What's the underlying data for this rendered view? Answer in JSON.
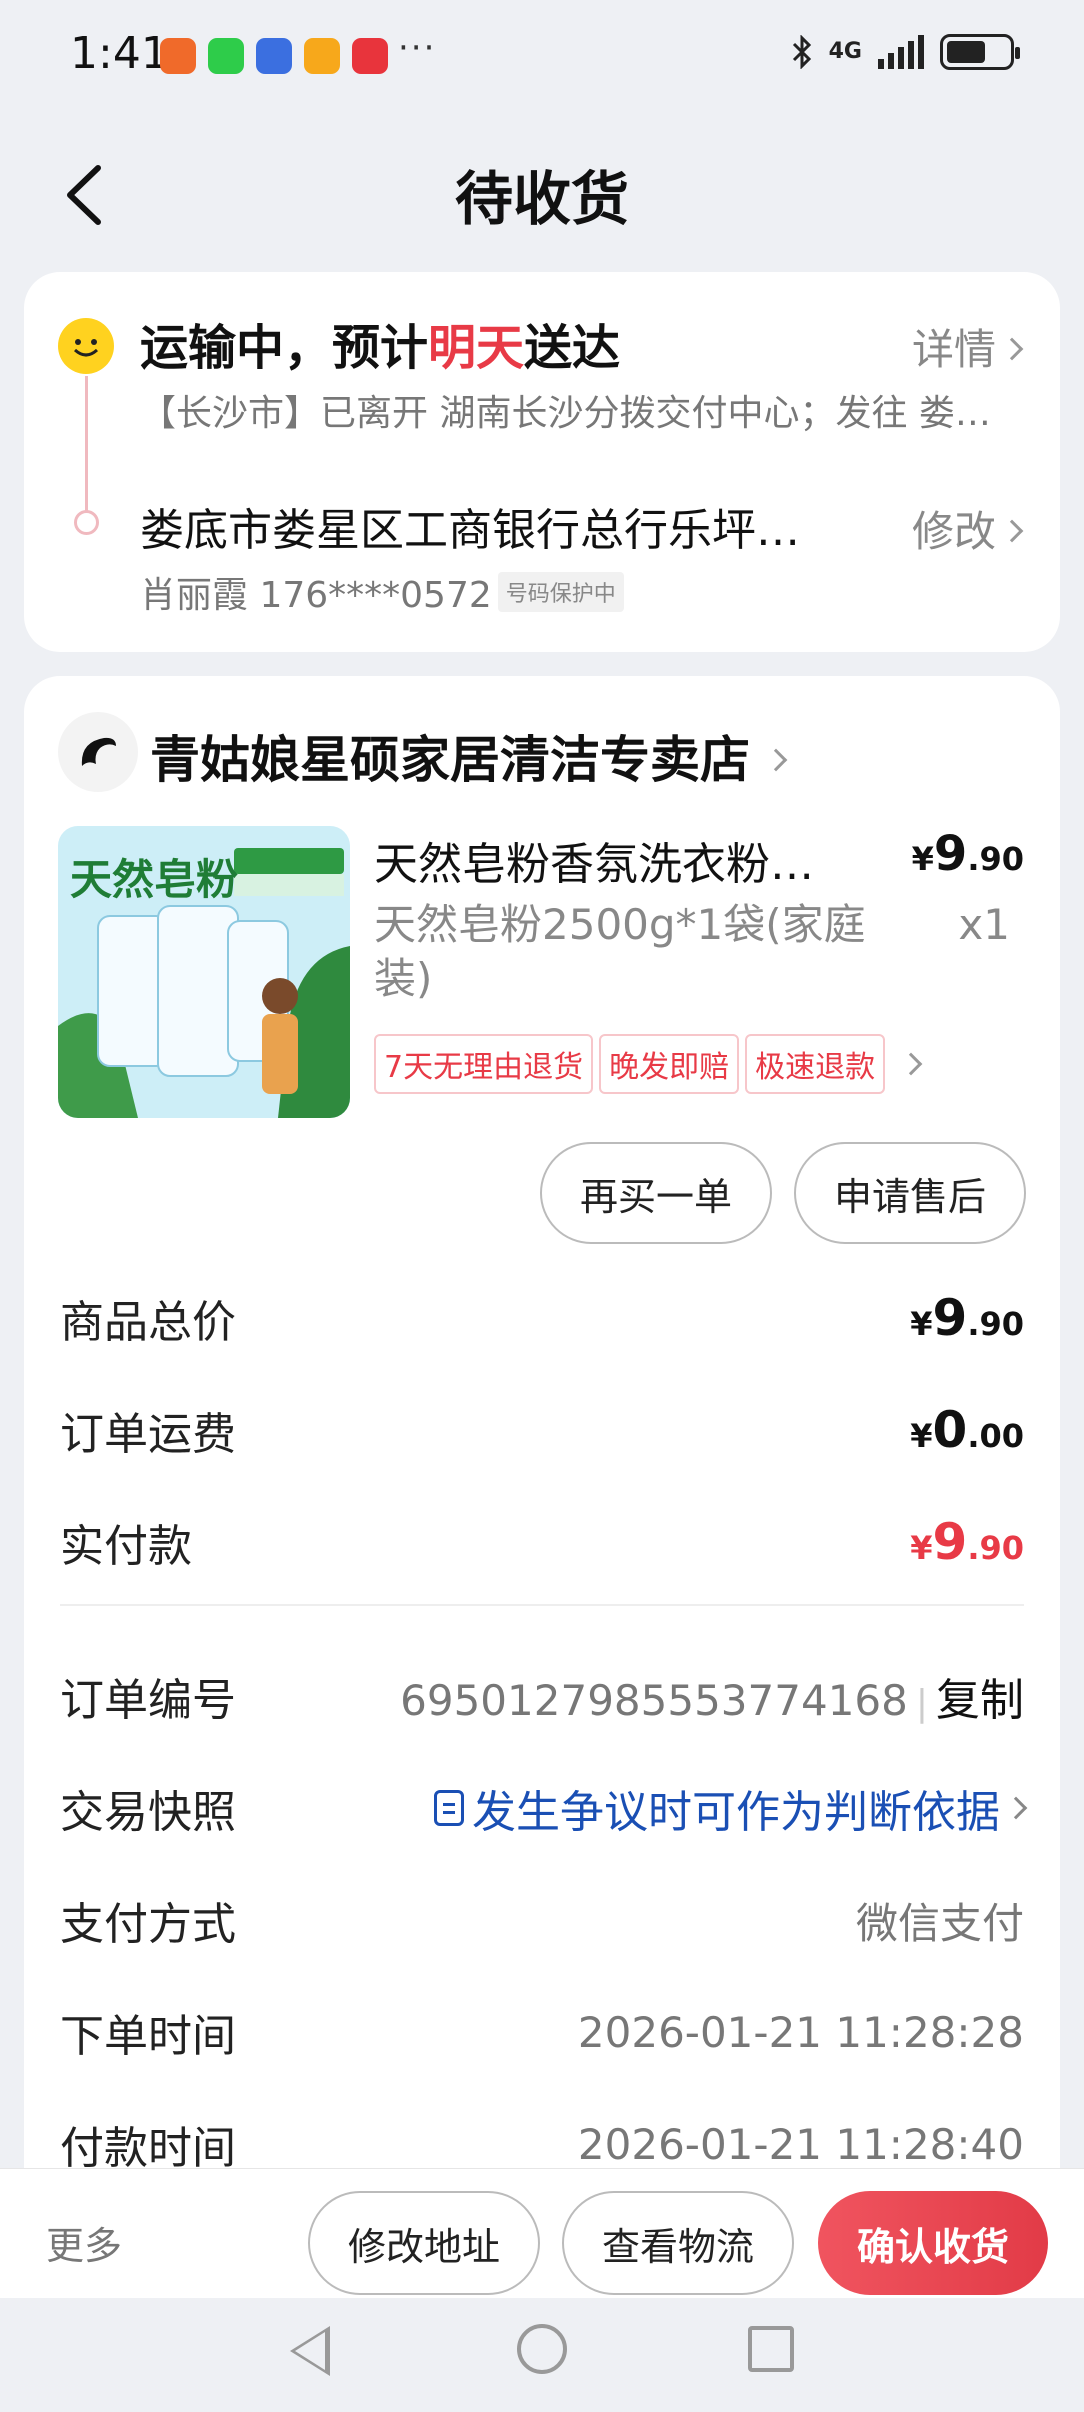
{
  "status_bar": {
    "time": "1:41",
    "network": "4G",
    "dots": "···"
  },
  "header": {
    "title": "待收货"
  },
  "shipping": {
    "status_prefix": "运输中，预计",
    "status_highlight": "明天",
    "status_suffix": "送达",
    "detail_link": "详情",
    "track_text": "【长沙市】已离开 湖南长沙分拨交付中心；发往 娄底转运中心",
    "address": "娄底市娄星区工商银行总行乐坪大道店",
    "edit_link": "修改",
    "recipient": "肖丽霞 176****0572",
    "protect_badge": "号码保护中"
  },
  "store": {
    "name": "青姑娘星硕家居清洁专卖店"
  },
  "product": {
    "name": "天然皂粉香氛洗衣粉家庭装",
    "price_yen": "¥",
    "price_int": "9",
    "price_dec": ".90",
    "spec": "天然皂粉2500g*1袋(家庭装)",
    "qty": "x1",
    "tags": [
      "7天无理由退货",
      "晚发即赔",
      "极速退款"
    ],
    "image_text": "天然皂粉"
  },
  "actions": {
    "rebuy": "再买一单",
    "after_sale": "申请售后"
  },
  "summary": {
    "goods_total_label": "商品总价",
    "goods_total": {
      "yen": "¥",
      "int": "9",
      "dec": ".90"
    },
    "freight_label": "订单运费",
    "freight": {
      "yen": "¥",
      "int": "0",
      "dec": ".00"
    },
    "paid_label": "实付款",
    "paid": {
      "yen": "¥",
      "int": "9",
      "dec": ".90"
    }
  },
  "info": {
    "order_no_label": "订单编号",
    "order_no": "6950127985553774168",
    "copy_label": "复制",
    "snapshot_label": "交易快照",
    "snapshot_text": "发生争议时可作为判断依据",
    "pay_method_label": "支付方式",
    "pay_method": "微信支付",
    "order_time_label": "下单时间",
    "order_time": "2026-01-21 11:28:28",
    "pay_time_label": "付款时间",
    "pay_time": "2026-01-21 11:28:40"
  },
  "bottom": {
    "more": "更多",
    "modify_address": "修改地址",
    "view_logistics": "查看物流",
    "confirm_receipt": "确认收货"
  },
  "colors": {
    "accent_red": "#e83a46",
    "link_blue": "#1a4fb4"
  }
}
